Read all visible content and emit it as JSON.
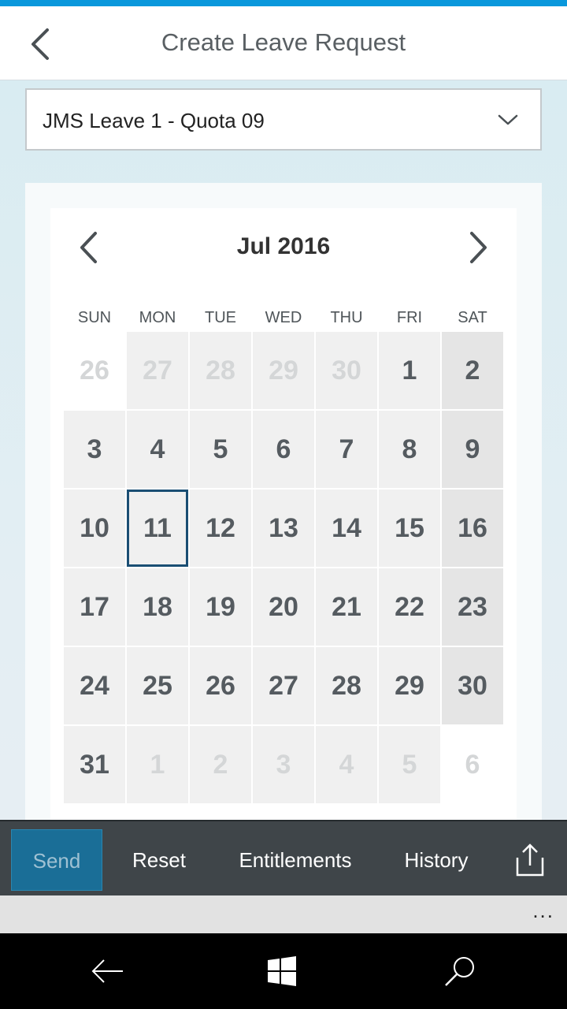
{
  "header": {
    "title": "Create Leave Request"
  },
  "leave_type": {
    "selected": "JMS Leave 1 - Quota 09"
  },
  "calendar": {
    "month_label": "Jul 2016",
    "weekdays": [
      "SUN",
      "MON",
      "TUE",
      "WED",
      "THU",
      "FRI",
      "SAT"
    ],
    "weeks": [
      [
        "26",
        "27",
        "28",
        "29",
        "30",
        "1",
        "2"
      ],
      [
        "3",
        "4",
        "5",
        "6",
        "7",
        "8",
        "9"
      ],
      [
        "10",
        "11",
        "12",
        "13",
        "14",
        "15",
        "16"
      ],
      [
        "17",
        "18",
        "19",
        "20",
        "21",
        "22",
        "23"
      ],
      [
        "24",
        "25",
        "26",
        "27",
        "28",
        "29",
        "30"
      ],
      [
        "31",
        "1",
        "2",
        "3",
        "4",
        "5",
        "6"
      ]
    ],
    "today": "11"
  },
  "toolbar": {
    "send": "Send",
    "reset": "Reset",
    "entitlements": "Entitlements",
    "history": "History"
  },
  "more": {
    "label": "..."
  },
  "icons": {
    "back": "back-chevron-icon",
    "dropdown": "chevron-down-icon",
    "prev_month": "chevron-left-icon",
    "next_month": "chevron-right-icon",
    "share": "share-icon",
    "nav_back": "back-arrow-icon",
    "nav_home": "windows-logo-icon",
    "nav_search": "search-icon"
  },
  "colors": {
    "accent_bar": "#0a98dc",
    "today_outline": "#1a4e73",
    "send_button": "#1a6e97",
    "toolbar_bg": "#3f4549"
  }
}
